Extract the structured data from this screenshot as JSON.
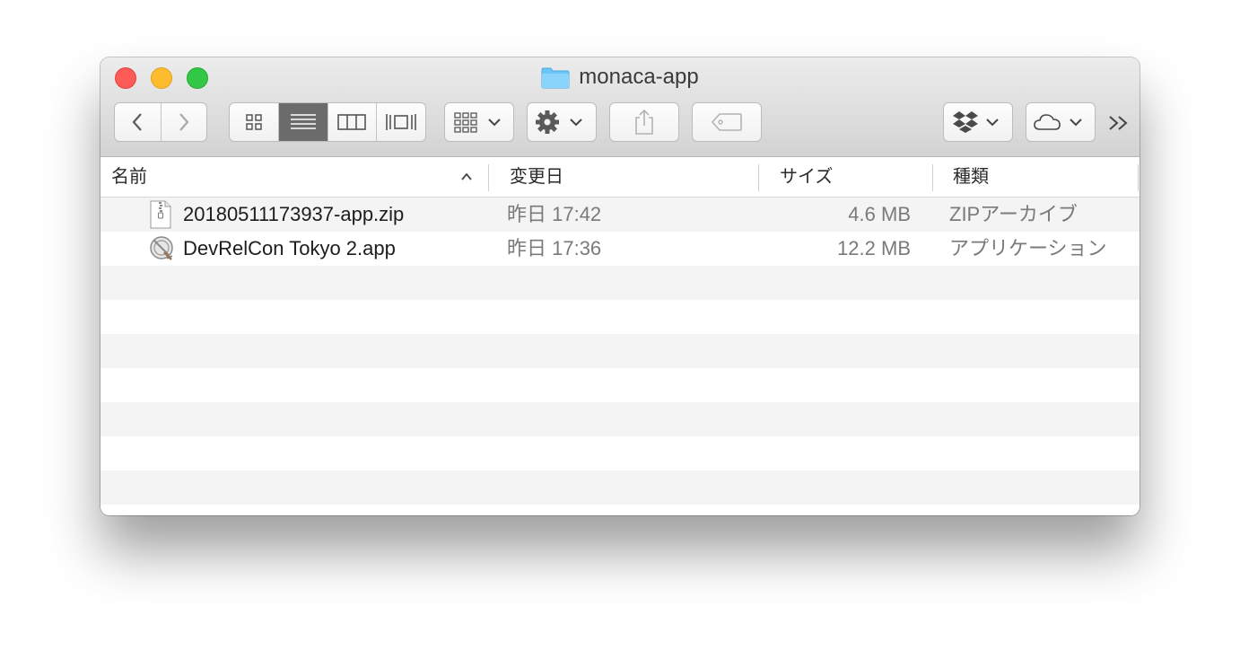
{
  "window": {
    "title": "monaca-app"
  },
  "toolbar": {
    "back": "back",
    "forward": "forward",
    "views": [
      "icon-view",
      "list-view",
      "column-view",
      "cover-flow-view"
    ],
    "active_view": "list-view"
  },
  "columns": {
    "name": "名前",
    "date": "変更日",
    "size": "サイズ",
    "kind": "種類"
  },
  "files": [
    {
      "name": "20180511173937-app.zip",
      "date": "昨日 17:42",
      "size": "4.6 MB",
      "kind": "ZIPアーカイブ",
      "icon": "zip-file-icon"
    },
    {
      "name": "DevRelCon Tokyo 2.app",
      "date": "昨日 17:36",
      "size": "12.2 MB",
      "kind": "アプリケーション",
      "icon": "app-icon"
    }
  ],
  "colors": {
    "close": "#fc5b57",
    "minimize": "#fdbc2e",
    "zoom": "#33c748",
    "folder": "#6cc5f7"
  }
}
